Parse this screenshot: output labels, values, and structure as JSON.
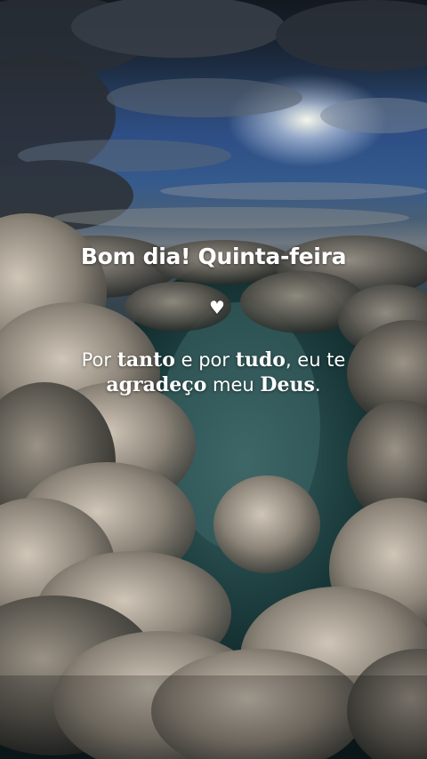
{
  "greeting": "Bom dia! Quinta-feira",
  "heart_icon": "heart-icon",
  "quote": {
    "line1": {
      "t1": "Por ",
      "t2": "tanto",
      "t3": " e por ",
      "t4": "tudo",
      "t5": ", eu te"
    },
    "line2": {
      "t1": "agradeço",
      "t2": " meu ",
      "t3": "Deus",
      "t4": "."
    }
  },
  "colors": {
    "text": "#ffffff",
    "sky": "#2e4f86",
    "clouds": "#b9b0a3"
  }
}
